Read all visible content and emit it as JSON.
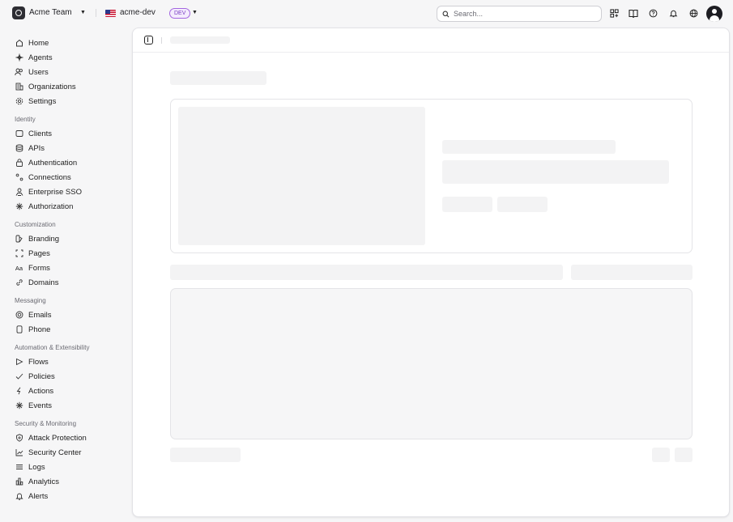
{
  "topbar": {
    "team_name": "Acme Team",
    "environment": "acme-dev",
    "env_badge": "DEV",
    "search_placeholder": "Search..."
  },
  "sidebar": {
    "main_items": [
      {
        "label": "Home",
        "icon": "home-icon"
      },
      {
        "label": "Agents",
        "icon": "sparkle-icon"
      },
      {
        "label": "Users",
        "icon": "users-icon"
      },
      {
        "label": "Organizations",
        "icon": "building-icon"
      },
      {
        "label": "Settings",
        "icon": "gear-icon"
      }
    ],
    "sections": [
      {
        "title": "Identity",
        "items": [
          {
            "label": "Clients",
            "icon": "window-icon"
          },
          {
            "label": "APIs",
            "icon": "database-icon"
          },
          {
            "label": "Authentication",
            "icon": "lock-icon"
          },
          {
            "label": "Connections",
            "icon": "connections-icon"
          },
          {
            "label": "Enterprise SSO",
            "icon": "sso-icon"
          },
          {
            "label": "Authorization",
            "icon": "asterisk-icon"
          }
        ]
      },
      {
        "title": "Customization",
        "items": [
          {
            "label": "Branding",
            "icon": "branding-icon"
          },
          {
            "label": "Pages",
            "icon": "pages-icon"
          },
          {
            "label": "Forms",
            "icon": "forms-icon"
          },
          {
            "label": "Domains",
            "icon": "link-icon"
          }
        ]
      },
      {
        "title": "Messaging",
        "items": [
          {
            "label": "Emails",
            "icon": "at-icon"
          },
          {
            "label": "Phone",
            "icon": "phone-icon"
          }
        ]
      },
      {
        "title": "Automation & Extensibility",
        "items": [
          {
            "label": "Flows",
            "icon": "flow-icon"
          },
          {
            "label": "Policies",
            "icon": "check-icon"
          },
          {
            "label": "Actions",
            "icon": "bolt-icon"
          },
          {
            "label": "Events",
            "icon": "events-icon"
          }
        ]
      },
      {
        "title": "Security & Monitoring",
        "items": [
          {
            "label": "Attack Protection",
            "icon": "shield-icon"
          },
          {
            "label": "Security Center",
            "icon": "chart-line-icon"
          },
          {
            "label": "Logs",
            "icon": "logs-icon"
          },
          {
            "label": "Analytics",
            "icon": "analytics-icon"
          },
          {
            "label": "Alerts",
            "icon": "bell-icon"
          }
        ]
      }
    ]
  }
}
